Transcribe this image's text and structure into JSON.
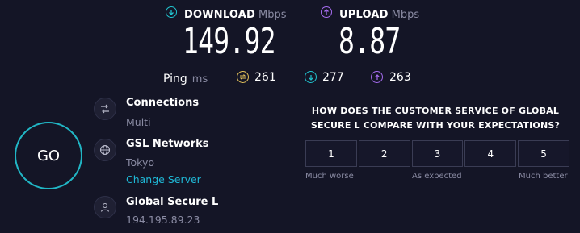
{
  "download": {
    "label": "DOWNLOAD",
    "unit": "Mbps",
    "value": "149.92"
  },
  "upload": {
    "label": "UPLOAD",
    "unit": "Mbps",
    "value": "8.87"
  },
  "ping": {
    "label": "Ping",
    "unit": "ms",
    "idle": "261",
    "download": "277",
    "upload": "263"
  },
  "go_label": "GO",
  "connections": {
    "title": "Connections",
    "value": "Multi"
  },
  "server": {
    "title": "GSL Networks",
    "location": "Tokyo",
    "change_link": "Change Server"
  },
  "provider": {
    "title": "Global Secure L",
    "ip": "194.195.89.23"
  },
  "survey": {
    "question_line1": "HOW DOES THE CUSTOMER SERVICE OF GLOBAL",
    "question_line2": "SECURE L COMPARE WITH YOUR EXPECTATIONS?",
    "options": [
      "1",
      "2",
      "3",
      "4",
      "5"
    ],
    "scale_low": "Much worse",
    "scale_mid": "As expected",
    "scale_high": "Much better"
  },
  "colors": {
    "background": "#141526",
    "download_accent": "#21c4cf",
    "upload_accent": "#a66cf0",
    "idle_ping_accent": "#e4c25a",
    "link": "#1fb8d6"
  }
}
